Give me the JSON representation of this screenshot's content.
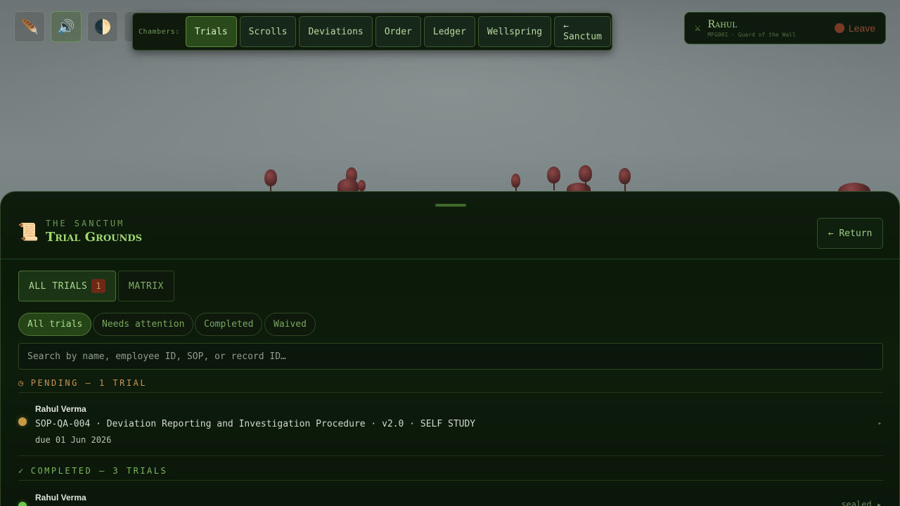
{
  "toolbar": {
    "icons": [
      "quill-icon",
      "speaker-icon",
      "moon-icon"
    ]
  },
  "chambers": {
    "label": "Chambers:",
    "items": [
      {
        "label": "Trials",
        "active": true
      },
      {
        "label": "Scrolls"
      },
      {
        "label": "Deviations"
      },
      {
        "label": "Order"
      },
      {
        "label": "Ledger"
      },
      {
        "label": "Wellspring"
      },
      {
        "label": "← Sanctum"
      }
    ]
  },
  "user": {
    "name": "Rahul",
    "subtitle": "MFG001 · Guard of the Wall",
    "leave_label": "Leave"
  },
  "panel": {
    "eyebrow": "THE SANCTUM",
    "title": "Trial Grounds",
    "return_label": "← Return"
  },
  "view_tabs": [
    {
      "label": "ALL TRIALS",
      "count": "1",
      "active": true
    },
    {
      "label": "MATRIX"
    }
  ],
  "filters": [
    {
      "label": "All trials",
      "active": true
    },
    {
      "label": "Needs attention"
    },
    {
      "label": "Completed"
    },
    {
      "label": "Waived"
    }
  ],
  "search": {
    "placeholder": "Search by name, employee ID, SOP, or record ID…"
  },
  "sections": {
    "pending": {
      "icon": "◷",
      "label": "PENDING — 1 TRIAL"
    },
    "completed": {
      "icon": "✓",
      "label": "COMPLETED — 3 TRIALS"
    }
  },
  "pending_rows": [
    {
      "name": "Rahul Verma",
      "detail": "SOP-QA-004 · Deviation Reporting and Investigation Procedure · v2.0 · SELF STUDY",
      "due": "due 01 Jun 2026",
      "chevron": "▸"
    }
  ],
  "completed_rows": [
    {
      "name": "Rahul Verma",
      "status": "sealed ▸"
    }
  ],
  "colors": {
    "accent": "#9ed86e",
    "pending": "#c89a44",
    "completed": "#6cc64a",
    "danger": "#8a4a30"
  }
}
